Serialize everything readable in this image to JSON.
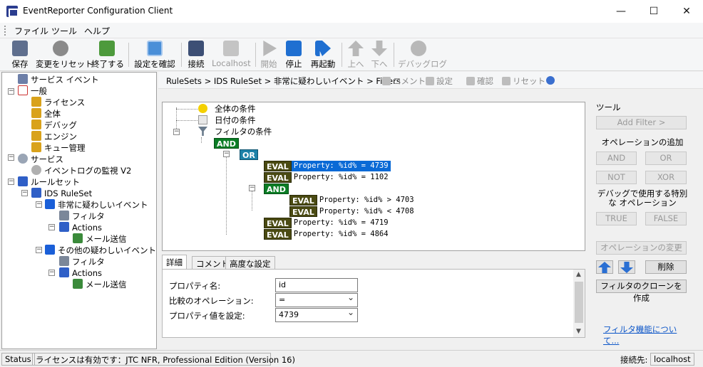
{
  "window": {
    "title": "EventReporter Configuration Client",
    "controls": [
      "—",
      "☐",
      "✕"
    ]
  },
  "menu": [
    "ファイル",
    "ツール",
    "ヘルプ"
  ],
  "toolbar": [
    {
      "label": "保存",
      "icon": "save-icon",
      "enabled": true
    },
    {
      "label": "変更をリセット",
      "icon": "reset-icon",
      "enabled": true
    },
    {
      "label": "終了する",
      "icon": "exit-icon",
      "enabled": true
    },
    {
      "label": "設定を確認",
      "icon": "verify-icon",
      "enabled": true
    },
    {
      "label": "接続",
      "icon": "connect-icon",
      "enabled": true
    },
    {
      "label": "Localhost",
      "icon": "localhost-icon",
      "enabled": false
    },
    {
      "label": "開始",
      "icon": "play-icon",
      "enabled": false
    },
    {
      "label": "停止",
      "icon": "stop-icon",
      "enabled": true
    },
    {
      "label": "再起動",
      "icon": "restart-icon",
      "enabled": true
    },
    {
      "label": "上へ",
      "icon": "up-arrow-icon",
      "enabled": false
    },
    {
      "label": "下へ",
      "icon": "down-arrow-icon",
      "enabled": false
    },
    {
      "label": "デバッグログ",
      "icon": "debug-icon",
      "enabled": false
    }
  ],
  "tree": [
    {
      "label": "サービス イベント",
      "icon": "window-icon"
    },
    {
      "label": "一般",
      "icon": "checklist-icon"
    },
    {
      "label": "ライセンス",
      "icon": "gear-icon"
    },
    {
      "label": "全体",
      "icon": "gear-icon"
    },
    {
      "label": "デバッグ",
      "icon": "gear-icon"
    },
    {
      "label": "エンジン",
      "icon": "gear-icon"
    },
    {
      "label": "キュー管理",
      "icon": "gear-icon"
    },
    {
      "label": "サービス",
      "icon": "services-icon"
    },
    {
      "label": "イベントログの監視 V2",
      "icon": "service-gear-icon"
    },
    {
      "label": "ルールセット",
      "icon": "ruleset-icon"
    },
    {
      "label": "IDS RuleSet",
      "icon": "ruleset-icon"
    },
    {
      "label": "非常に疑わしいイベント",
      "icon": "rule-cube-icon"
    },
    {
      "label": "フィルタ",
      "icon": "filter-icon"
    },
    {
      "label": "Actions",
      "icon": "actions-icon"
    },
    {
      "label": "メール送信",
      "icon": "mail-icon"
    },
    {
      "label": "その他の疑わしいイベント",
      "icon": "rule-cube-icon"
    },
    {
      "label": "フィルタ",
      "icon": "filter-icon"
    },
    {
      "label": "Actions",
      "icon": "actions-icon"
    },
    {
      "label": "メール送信",
      "icon": "mail-icon"
    }
  ],
  "breadcrumb": "RuleSets > IDS RuleSet > 非常に疑わしいイベント > Filters",
  "header_buttons": [
    "コメント",
    "設定",
    "確認",
    "リセット"
  ],
  "filter_tree": {
    "global": "全体の条件",
    "date": "日付の条件",
    "filter": "フィルタの条件",
    "and": "AND",
    "or": "OR",
    "eval": "EVAL",
    "items": [
      "Property: %id% = 4739",
      "Property: %id% = 1102",
      "Property: %id% >  4703",
      "Property: %id% < 4708",
      "Property: %id% = 4719",
      "Property: %id% = 4864"
    ]
  },
  "detail_tabs": [
    "詳細",
    "コメント",
    "高度な設定"
  ],
  "details": {
    "property_name_label": "プロパティ名:",
    "property_name_value": "id",
    "compare_label": "比較のオペレーション:",
    "compare_value": "=",
    "value_label": "プロパティ値を設定:",
    "value_value": "4739"
  },
  "tools": {
    "title": "ツール",
    "add_filter": "Add Filter >",
    "add_operation": "オペレーションの追加",
    "and": "AND",
    "or": "OR",
    "not": "NOT",
    "xor": "XOR",
    "debug_label": "デバッグで使用する特別な オペレーション",
    "true": "TRUE",
    "false": "FALSE",
    "change_op": "オペレーションの変更",
    "delete": "削除",
    "clone": "フィルタのクローンを作成",
    "about": "フィルタ機能について..."
  },
  "status": {
    "status_label": "Status",
    "license_text": "ライセンスは有効です：JTC NFR, Professional Edition (Version 16)",
    "connect_label": "接続先:",
    "connect_value": "localhost"
  }
}
